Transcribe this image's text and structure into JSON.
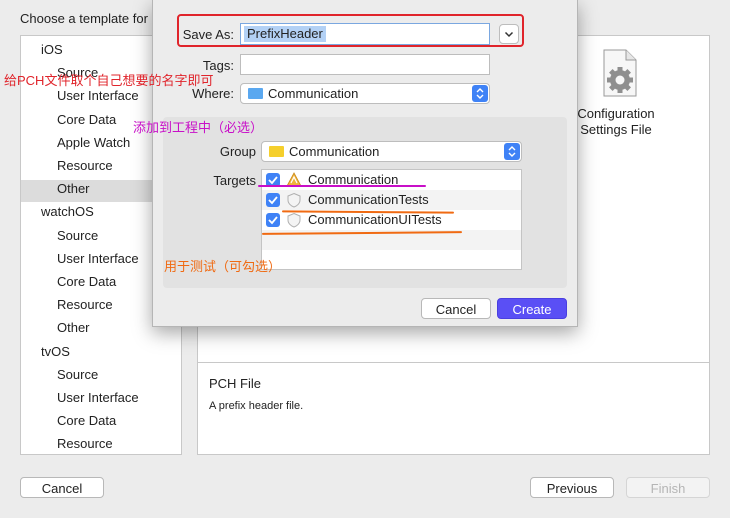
{
  "background": {
    "title": "Choose a template for",
    "sidebar": [
      {
        "label": "iOS",
        "kind": "platform"
      },
      {
        "label": "Source",
        "kind": "sub"
      },
      {
        "label": "User Interface",
        "kind": "sub"
      },
      {
        "label": "Core Data",
        "kind": "sub"
      },
      {
        "label": "Apple Watch",
        "kind": "sub"
      },
      {
        "label": "Resource",
        "kind": "sub"
      },
      {
        "label": "Other",
        "kind": "sub",
        "selected": true
      },
      {
        "label": "watchOS",
        "kind": "platform"
      },
      {
        "label": "Source",
        "kind": "sub"
      },
      {
        "label": "User Interface",
        "kind": "sub"
      },
      {
        "label": "Core Data",
        "kind": "sub"
      },
      {
        "label": "Resource",
        "kind": "sub"
      },
      {
        "label": "Other",
        "kind": "sub"
      },
      {
        "label": "tvOS",
        "kind": "platform"
      },
      {
        "label": "Source",
        "kind": "sub"
      },
      {
        "label": "User Interface",
        "kind": "sub"
      },
      {
        "label": "Core Data",
        "kind": "sub"
      },
      {
        "label": "Resource",
        "kind": "sub"
      }
    ],
    "template_label": "Configuration Settings File",
    "template_icon": "gear-document-icon",
    "description_title": "PCH File",
    "description_text": "A prefix header file.",
    "cancel_label": "Cancel",
    "previous_label": "Previous",
    "finish_label": "Finish"
  },
  "sheet": {
    "save_as_label": "Save As:",
    "save_as_value": "PrefixHeader",
    "tags_label": "Tags:",
    "tags_value": "",
    "where_label": "Where:",
    "where_value": "Communication",
    "group_label": "Group",
    "group_value": "Communication",
    "targets_label": "Targets",
    "targets": [
      {
        "name": "Communication",
        "checked": true,
        "icon": "app-target-icon"
      },
      {
        "name": "CommunicationTests",
        "checked": true,
        "icon": "test-target-icon"
      },
      {
        "name": "CommunicationUITests",
        "checked": true,
        "icon": "test-target-icon"
      }
    ],
    "cancel_label": "Cancel",
    "create_label": "Create"
  },
  "annotations": {
    "name_hint": "给PCH文件取个自己想要的名字即可",
    "add_to_project": "添加到工程中（必选）",
    "for_testing": "用于测试（可勾选）"
  },
  "colors": {
    "highlight_red": "#e0242b",
    "annotation_pink": "#c80fc8",
    "annotation_orange": "#f06a12",
    "accent_blue": "#3f82f6",
    "create_button": "#5a4ff5",
    "folder_yellow": "#f5cf2c",
    "folder_blue": "#5aa8f0"
  }
}
